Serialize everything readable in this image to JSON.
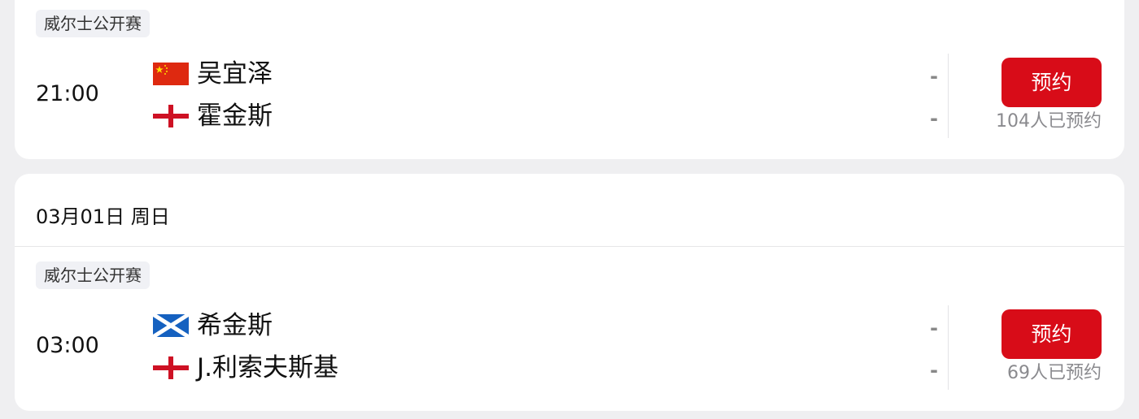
{
  "matches": [
    {
      "tournament": "威尔士公开赛",
      "time": "21:00",
      "team_a": {
        "name": "吴宜泽",
        "flag": "china-flag-icon"
      },
      "team_b": {
        "name": "霍金斯",
        "flag": "england-flag-icon"
      },
      "score_a": "-",
      "score_b": "-",
      "reserve_label": "预约",
      "reserve_count": "104人已预约"
    },
    {
      "date": "03月01日 周日",
      "tournament": "威尔士公开赛",
      "time": "03:00",
      "team_a": {
        "name": "希金斯",
        "flag": "scotland-flag-icon"
      },
      "team_b": {
        "name": "J.利索夫斯基",
        "flag": "england-flag-icon"
      },
      "score_a": "-",
      "score_b": "-",
      "reserve_label": "预约",
      "reserve_count": "69人已预约"
    }
  ],
  "colors": {
    "page_background": "#efeff1",
    "card_background": "#ffffff",
    "accent_button": "#d80c18",
    "tag_background": "#f0f1f5",
    "muted_text": "#8a8a8e"
  }
}
